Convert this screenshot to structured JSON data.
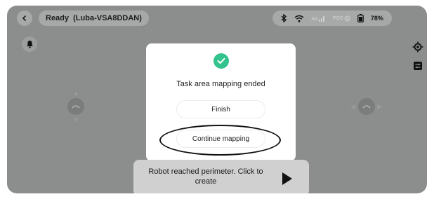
{
  "header": {
    "status_text": "Ready  (Luba-VSA8DDAN)",
    "signal_label": "4G",
    "pos_label": "POS",
    "battery_percent": "78%"
  },
  "dialog": {
    "message": "Task area mapping ended",
    "finish_label": "Finish",
    "continue_label": "Continue mapping"
  },
  "toast": {
    "message": "Robot reached perimeter. Click to create"
  },
  "icons": {
    "back": "chevron-left-icon",
    "bluetooth": "bluetooth-icon",
    "wifi": "wifi-icon",
    "battery": "battery-icon",
    "bell": "bell-icon",
    "locate": "locate-icon",
    "settings": "settings-icon",
    "play": "play-icon",
    "check": "check-icon"
  },
  "colors": {
    "success": "#34c38f",
    "overlay": "#8c8d8d"
  }
}
